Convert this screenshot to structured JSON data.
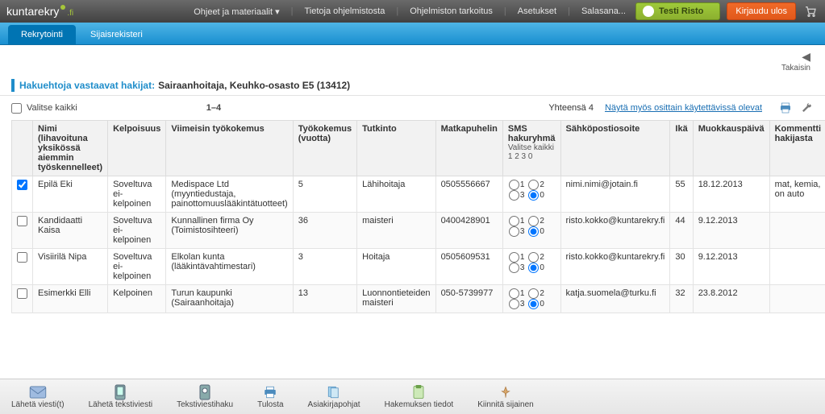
{
  "top": {
    "logo_main": "kuntarekry",
    "logo_suffix": ".fi",
    "menu": {
      "help": "Ohjeet ja materiaalit",
      "about": "Tietoja ohjelmistosta",
      "purpose": "Ohjelmiston tarkoitus",
      "settings": "Asetukset",
      "secret": "Salasana..."
    },
    "user": "Testi Risto",
    "logout": "Kirjaudu ulos"
  },
  "tabs": {
    "recruit": "Rekrytointi",
    "substitute": "Sijaisrekisteri"
  },
  "back": "Takaisin",
  "header": {
    "label": "Hakuehtoja vastaavat hakijat:",
    "value": "Sairaanhoitaja, Keuhko-osasto E5 (13412)"
  },
  "listbar": {
    "select_all": "Valitse kaikki",
    "range": "1–4",
    "total": "Yhteensä 4",
    "partial_link": "Näytä myös osittain käytettävissä olevat"
  },
  "columns": {
    "name": "Nimi (lihavoituna yksikössä aiemmin työskennelleet)",
    "eligibility": "Kelpoisuus",
    "lastjob": "Viimeisin työkokemus",
    "expyears": "Työkokemus (vuotta)",
    "degree": "Tutkinto",
    "mobile": "Matkapuhelin",
    "sms": "SMS hakuryhmä",
    "sms_sub": "Valitse kaikki 1  2  3  0",
    "email": "Sähköpostiosoite",
    "age": "Ikä",
    "modified": "Muokkauspäivä",
    "comment": "Kommentti hakijasta"
  },
  "rows": [
    {
      "checked": true,
      "name": "Epilä Eki",
      "eligibility": "Soveltuva ei-kelpoinen",
      "lastjob": "Medispace Ltd (myyntiedustaja, painottomuuslääkintätuotteet)",
      "expyears": "5",
      "degree": "Lähihoitaja",
      "mobile": "0505556667",
      "sms_selected": "0",
      "email": "nimi.nimi@jotain.fi",
      "age": "55",
      "modified": "18.12.2013",
      "comment": "mat, kemia, on auto"
    },
    {
      "checked": false,
      "name": "Kandidaatti Kaisa",
      "eligibility": "Soveltuva ei-kelpoinen",
      "lastjob": "Kunnallinen firma Oy (Toimistosihteeri)",
      "expyears": "36",
      "degree": "maisteri",
      "mobile": "0400428901",
      "sms_selected": "0",
      "email": "risto.kokko@kuntarekry.fi",
      "age": "44",
      "modified": "9.12.2013",
      "comment": ""
    },
    {
      "checked": false,
      "name": "Visiirilä Nipa",
      "eligibility": "Soveltuva ei-kelpoinen",
      "lastjob": "Elkolan kunta (lääkintävahtimestari)",
      "expyears": "3",
      "degree": "Hoitaja",
      "mobile": "0505609531",
      "sms_selected": "0",
      "email": "risto.kokko@kuntarekry.fi",
      "age": "30",
      "modified": "9.12.2013",
      "comment": ""
    },
    {
      "checked": false,
      "name": "Esimerkki Elli",
      "eligibility": "Kelpoinen",
      "lastjob": "Turun kaupunki (Sairaanhoitaja)",
      "expyears": "13",
      "degree": "Luonnontieteiden maisteri",
      "mobile": "050-5739977",
      "sms_selected": "0",
      "email": "katja.suomela@turku.fi",
      "age": "32",
      "modified": "23.8.2012",
      "comment": ""
    }
  ],
  "bottom": {
    "send_msg": "Lähetä viesti(t)",
    "send_sms": "Lähetä tekstiviesti",
    "sms_search": "Tekstiviestihaku",
    "print": "Tulosta",
    "doc_templates": "Asiakirjapohjat",
    "app_info": "Hakemuksen tiedot",
    "attach_sub": "Kiinnitä sijainen"
  }
}
